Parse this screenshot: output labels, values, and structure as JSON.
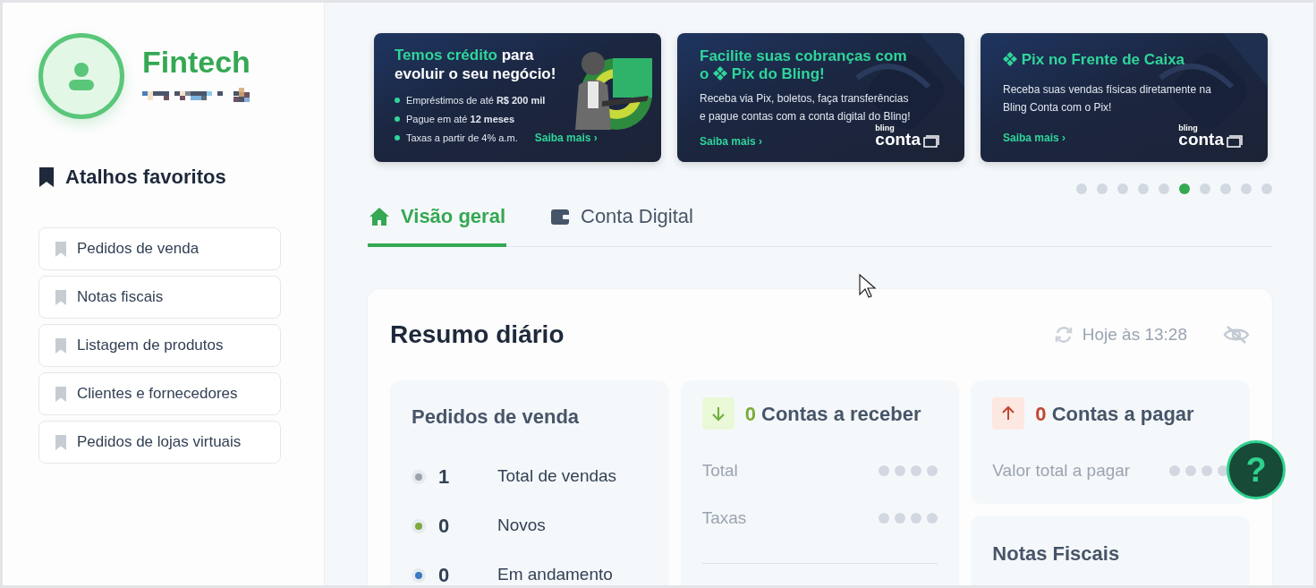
{
  "profile": {
    "name": "Fintech"
  },
  "shortcuts": {
    "title": "Atalhos favoritos",
    "items": [
      {
        "label": "Pedidos de venda"
      },
      {
        "label": "Notas fiscais"
      },
      {
        "label": "Listagem de produtos"
      },
      {
        "label": "Clientes e fornecedores"
      },
      {
        "label": "Pedidos de lojas virtuais"
      }
    ]
  },
  "banners": [
    {
      "kind": "credit",
      "title_highlight": "Temos crédito",
      "title_rest": "para evoluir o seu negócio!",
      "bullets": [
        "Empréstimos de até **R$ 200 mil**",
        "Pague em até **12 meses**",
        "Taxas a partir de 4% a.m."
      ],
      "link": "Saiba mais ›"
    },
    {
      "kind": "pix",
      "title_before": "Facilite suas cobranças com o",
      "title_after": "Pix do Bling!",
      "text": "Receba via Pix, boletos, faça transferências e pague contas com a conta digital do Bling!",
      "link": "Saiba mais ›",
      "logo_top": "bling",
      "logo_main": "conta"
    },
    {
      "kind": "pix_title",
      "title_after": "Pix no Frente de Caixa",
      "text": "Receba suas vendas físicas diretamente na Bling Conta com o Pix!",
      "link": "Saiba mais ›",
      "logo_top": "bling",
      "logo_main": "conta"
    }
  ],
  "carousel_dots": [
    {
      "selected": false
    },
    {
      "selected": false
    },
    {
      "selected": false
    },
    {
      "selected": false
    },
    {
      "selected": false
    },
    {
      "selected": true
    },
    {
      "selected": false
    },
    {
      "selected": false
    },
    {
      "selected": false
    },
    {
      "selected": false
    }
  ],
  "tabs": [
    {
      "label": "Visão geral",
      "selected": true
    },
    {
      "label": "Conta Digital",
      "selected": false
    }
  ],
  "summary": {
    "title": "Resumo diário",
    "updated": "Hoje às 13:28"
  },
  "orders": {
    "title": "Pedidos de venda",
    "rows": [
      {
        "value": "1",
        "label": "Total de vendas",
        "color": "#9ca3af"
      },
      {
        "value": "0",
        "label": "Novos",
        "color": "#7cab3c"
      },
      {
        "value": "0",
        "label": "Em andamento",
        "color": "#3b7bc4"
      }
    ]
  },
  "receivables": {
    "count": "0",
    "title": "Contas a receber",
    "rows": [
      {
        "label": "Total"
      },
      {
        "label": "Taxas"
      }
    ]
  },
  "payables": {
    "count": "0",
    "title": "Contas a pagar",
    "rows": [
      {
        "label": "Valor total a pagar"
      }
    ]
  },
  "invoices": {
    "title": "Notas Fiscais"
  },
  "help": {
    "label": "?"
  }
}
